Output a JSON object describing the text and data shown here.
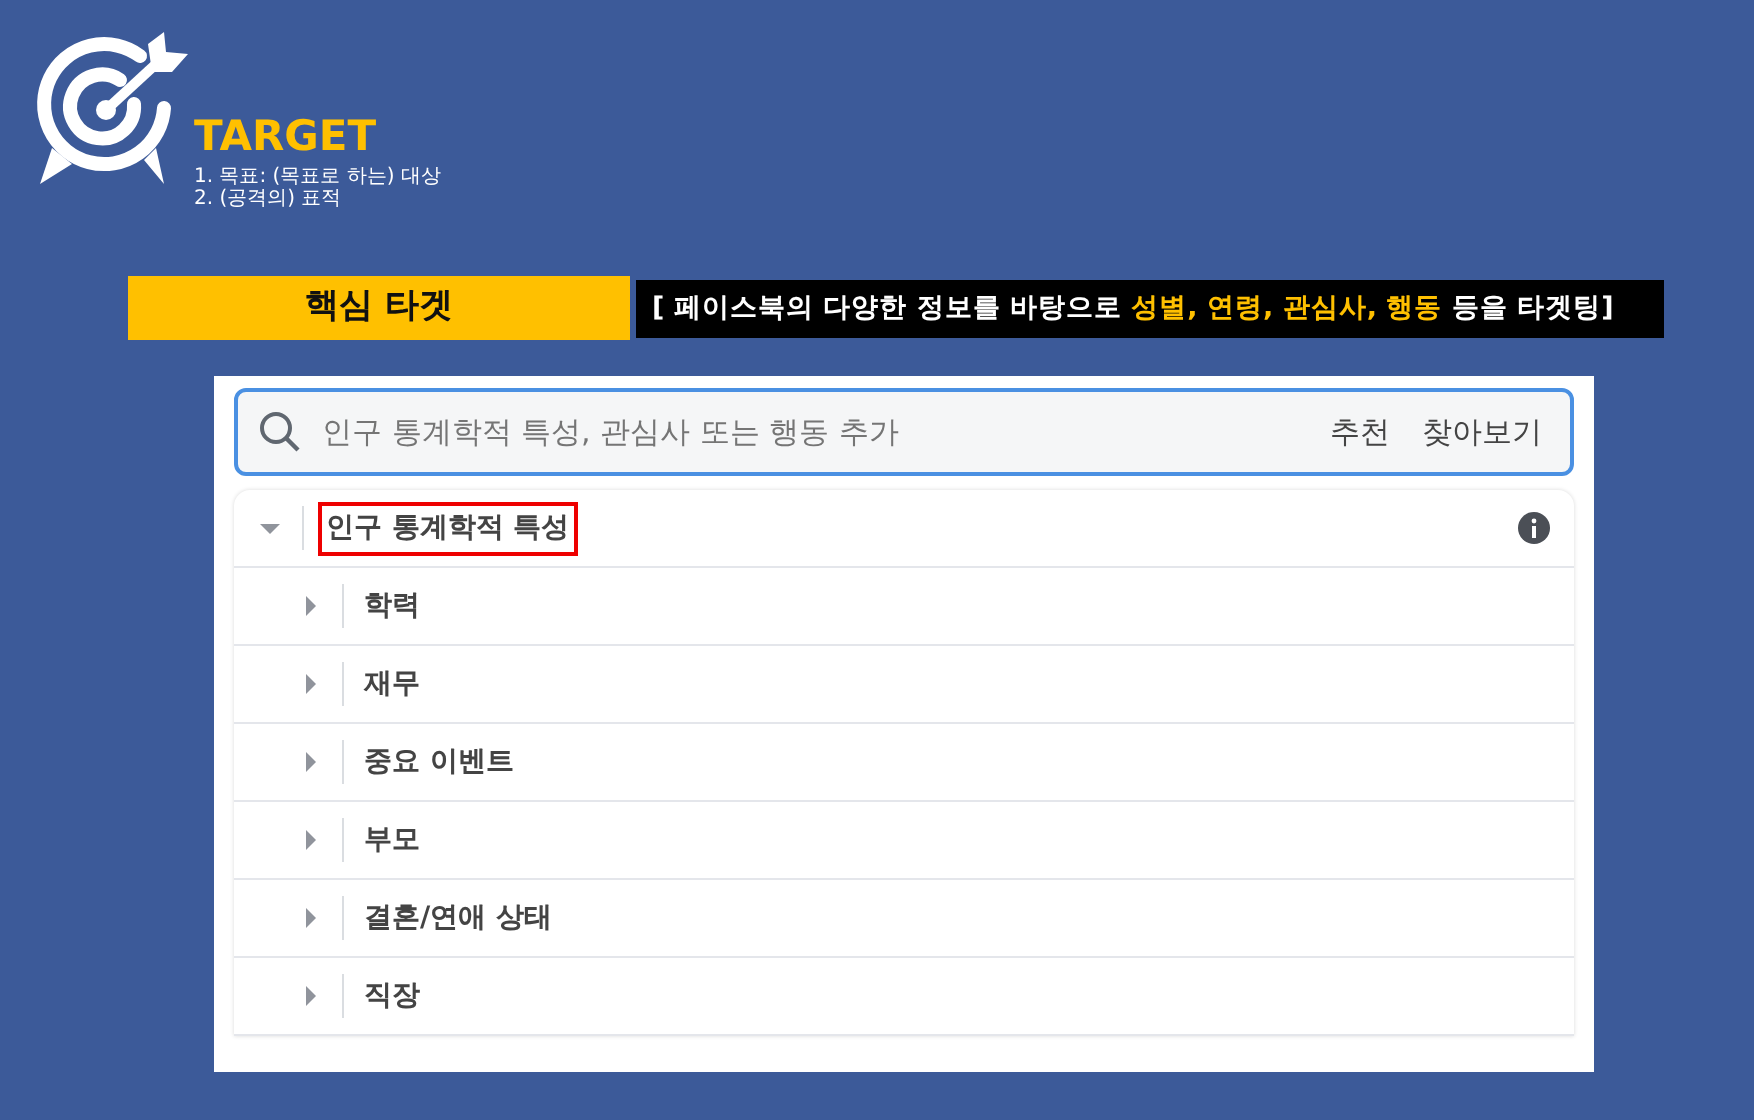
{
  "logo": {
    "title": "TARGET",
    "notes": [
      "1. 목표: (목표로 하는) 대상",
      "2. (공격의) 표적"
    ]
  },
  "heading": {
    "label": "핵심 타겟",
    "segments": [
      {
        "text": "[ 페이스북의 다양한 정보를 바탕으로 ",
        "highlight": false
      },
      {
        "text": "성별, 연령, 관심사, 행동",
        "highlight": true
      },
      {
        "text": " 등을 타겟팅]",
        "highlight": false
      }
    ]
  },
  "search": {
    "placeholder": "인구 통계학적 특성, 관심사 또는 행동 추가",
    "links": [
      "추천",
      "찾아보기"
    ]
  },
  "tree": [
    {
      "label": "인구 통계학적 특성",
      "expanded": true,
      "highlighted": true,
      "children": [
        {
          "label": "학력",
          "expanded": false
        },
        {
          "label": "재무",
          "expanded": false
        },
        {
          "label": "중요 이벤트",
          "expanded": false
        },
        {
          "label": "부모",
          "expanded": false
        },
        {
          "label": "결혼/연애 상태",
          "expanded": false
        },
        {
          "label": "직장",
          "expanded": false
        }
      ]
    }
  ]
}
